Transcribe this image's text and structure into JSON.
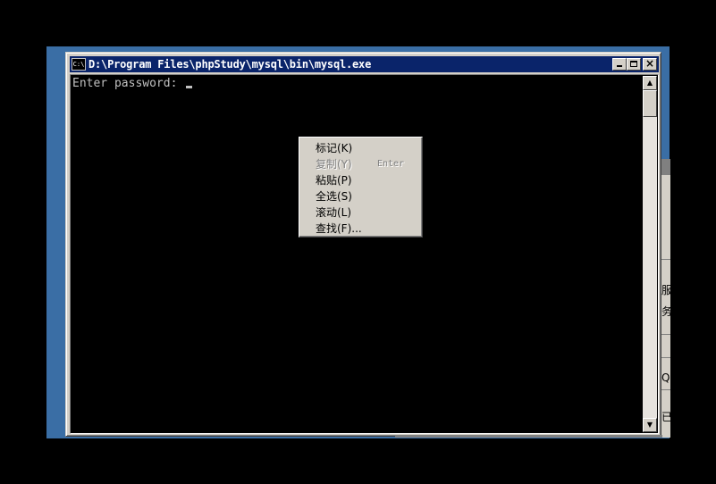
{
  "window": {
    "title": "D:\\Program Files\\phpStudy\\mysql\\bin\\mysql.exe",
    "icon_label": "C:\\"
  },
  "console": {
    "prompt": "Enter password: "
  },
  "scrollbar": {
    "up_icon": "▲",
    "down_icon": "▼"
  },
  "context_menu": {
    "items": [
      {
        "label": "标记(K)",
        "shortcut": "",
        "disabled": false
      },
      {
        "label": "复制(Y)",
        "shortcut": "Enter",
        "disabled": true
      },
      {
        "label": "粘贴(P)",
        "shortcut": "",
        "disabled": false
      },
      {
        "label": "全选(S)",
        "shortcut": "",
        "disabled": false
      },
      {
        "label": "滚动(L)",
        "shortcut": "",
        "disabled": false
      },
      {
        "label": "查找(F)...",
        "shortcut": "",
        "disabled": false
      }
    ]
  },
  "background_window": {
    "glyphs": [
      "服",
      "务",
      "QL",
      "已"
    ]
  },
  "colors": {
    "desktop": "#3a6ea5",
    "titlebar": "#0a246a",
    "console_bg": "#000000",
    "console_text": "#c0c0c0",
    "menu_bg": "#d4d0c8"
  }
}
